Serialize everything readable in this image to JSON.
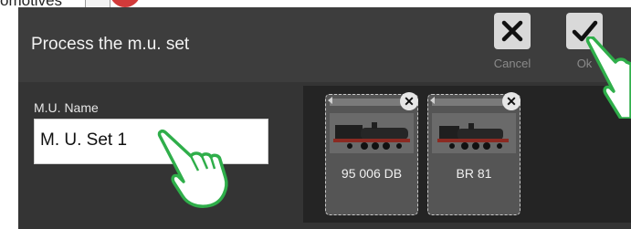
{
  "top_fragment": "omotives",
  "dialog": {
    "title": "Process the m.u. set",
    "cancel_label": "Cancel",
    "ok_label": "Ok"
  },
  "mu_name": {
    "label": "M.U. Name",
    "value": "M. U. Set 1"
  },
  "locomotives": [
    {
      "name": "95 006 DB"
    },
    {
      "name": "BR 81"
    }
  ],
  "colors": {
    "dialog_bg": "#343434",
    "header_bg": "#3d3d3d",
    "hand_outline": "#2fae4a"
  }
}
